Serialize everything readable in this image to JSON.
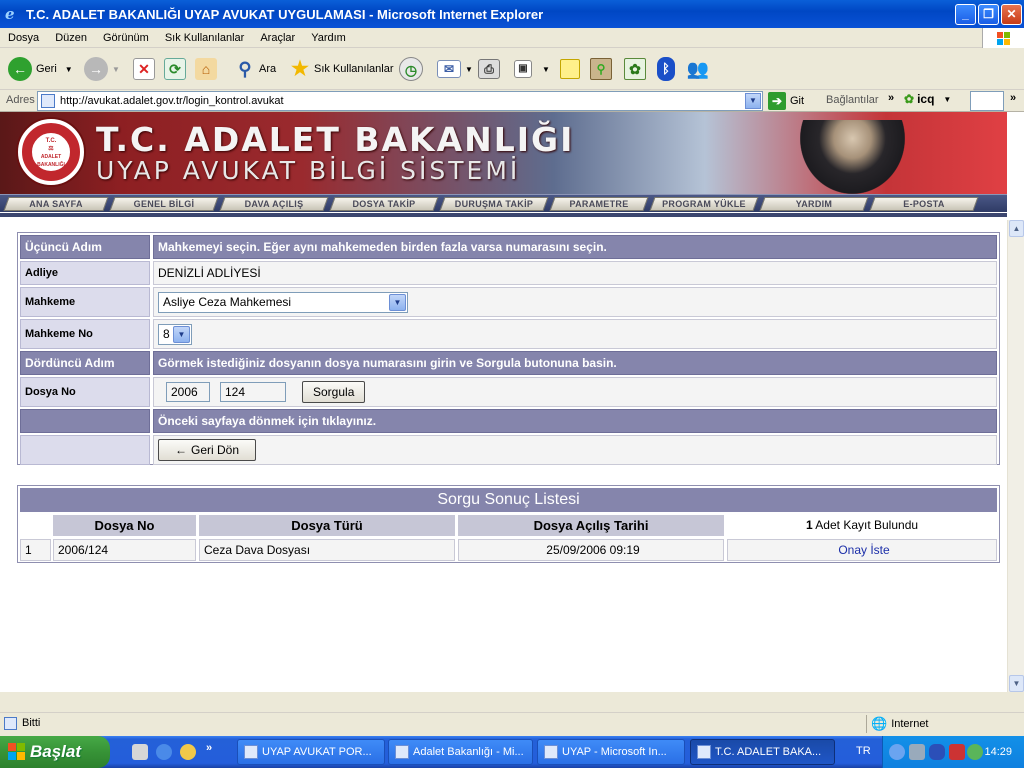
{
  "window": {
    "title": "T.C. ADALET BAKANLIĞI UYAP AVUKAT UYGULAMASI - Microsoft Internet Explorer"
  },
  "menu": [
    "Dosya",
    "Düzen",
    "Görünüm",
    "Sık Kullanılanlar",
    "Araçlar",
    "Yardım"
  ],
  "toolbar": {
    "back": "Geri",
    "search": "Ara",
    "favorites": "Sık Kullanılanlar"
  },
  "address": {
    "label": "Adres",
    "url": "http://avukat.adalet.gov.tr/login_kontrol.avukat",
    "go": "Git",
    "links": "Bağlantılar",
    "icq": "icq"
  },
  "banner": {
    "line1": "T.C. ADALET BAKANLIĞI",
    "line2": "UYAP AVUKAT BİLGİ SİSTEMİ",
    "seal_top": "T.C.",
    "seal_bottom": "ADALET BAKANLIĞI"
  },
  "nav": [
    "ANA SAYFA",
    "GENEL BİLGİ",
    "DAVA AÇILIŞ",
    "DOSYA TAKİP",
    "DURUŞMA TAKİP",
    "PARAMETRE",
    "PROGRAM YÜKLE",
    "YARDIM",
    "E-POSTA"
  ],
  "form": {
    "step3_label": "Üçüncü Adım",
    "step3_text": "Mahkemeyi seçin. Eğer aynı mahkemeden birden fazla varsa numarasını seçin.",
    "adliye_label": "Adliye",
    "adliye_value": "DENİZLİ ADLİYESİ",
    "mahkeme_label": "Mahkeme",
    "mahkeme_value": "Asliye Ceza Mahkemesi",
    "mahkeme_no_label": "Mahkeme No",
    "mahkeme_no_value": "8",
    "step4_label": "Dördüncü Adım",
    "step4_text": "Görmek istediğiniz dosyanın dosya numarasını girin ve Sorgula butonuna basin.",
    "dosya_no_label": "Dosya No",
    "dosya_year": "2006",
    "dosya_num": "124",
    "sorgula": "Sorgula",
    "back_text": "Önceki sayfaya dönmek için tıklayınız.",
    "back_button": "Geri Dön"
  },
  "results": {
    "title": "Sorgu Sonuç Listesi",
    "headers": [
      "Dosya No",
      "Dosya Türü",
      "Dosya Açılış Tarihi"
    ],
    "count": "1",
    "count_text": "Adet Kayıt Bulundu",
    "rows": [
      {
        "idx": "1",
        "dosya_no": "2006/124",
        "tur": "Ceza Dava Dosyası",
        "tarih": "25/09/2006 09:19",
        "action": "Onay İste"
      }
    ]
  },
  "status": {
    "text": "Bitti",
    "zone": "Internet"
  },
  "taskbar": {
    "start": "Başlat",
    "tasks": [
      "UYAP AVUKAT POR...",
      "Adalet Bakanlığı - Mi...",
      "UYAP - Microsoft In...",
      "T.C. ADALET BAKA..."
    ],
    "lang": "TR",
    "clock": "14:29"
  }
}
